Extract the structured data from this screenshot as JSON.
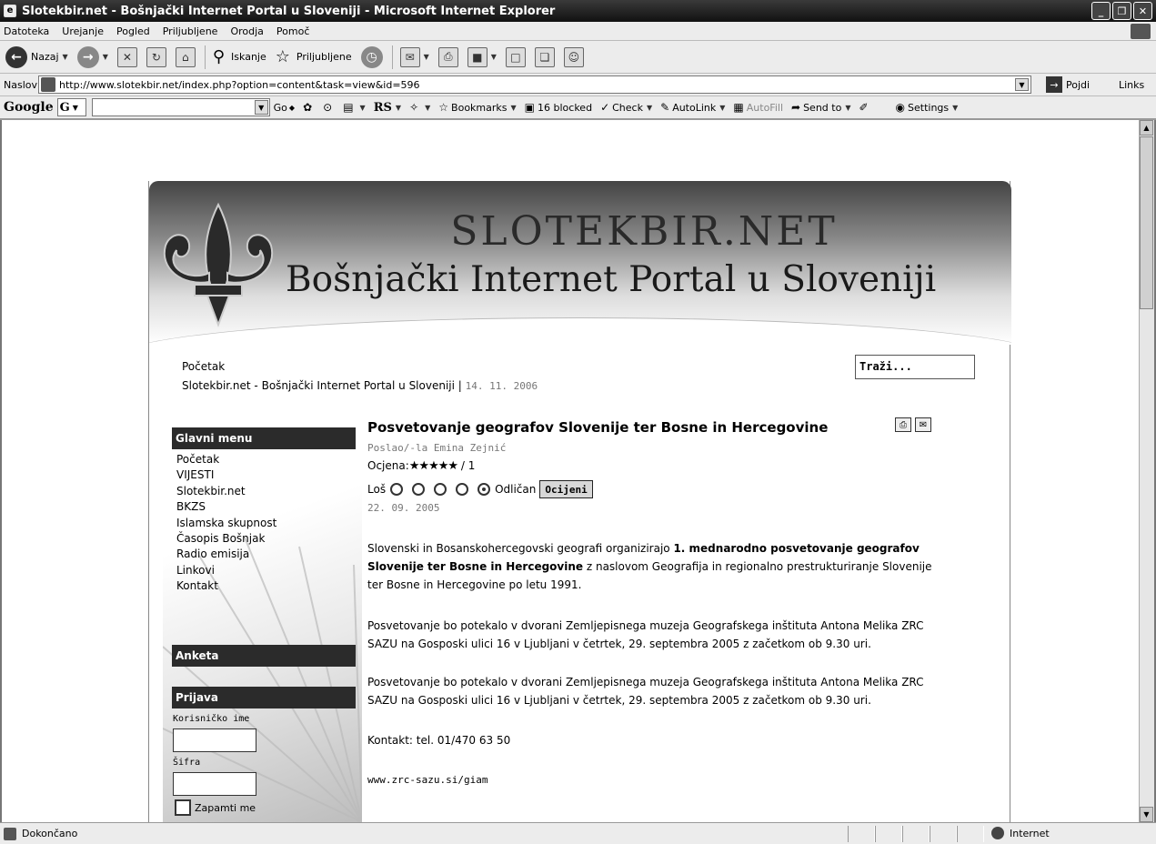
{
  "window": {
    "title": "Slotekbir.net - Bošnjački Internet Portal u Sloveniji - Microsoft Internet Explorer"
  },
  "menu": [
    "Datoteka",
    "Urejanje",
    "Pogled",
    "Priljubljene",
    "Orodja",
    "Pomoč"
  ],
  "toolbar": {
    "back": "Nazaj",
    "search": "Iskanje",
    "favorites": "Priljubljene"
  },
  "address": {
    "label": "Naslov",
    "url": "http://www.slotekbir.net/index.php?option=content&task=view&id=596",
    "go": "Pojdi",
    "links": "Links"
  },
  "google": {
    "logo": "Google",
    "g_button": "G",
    "go": "Go",
    "rs": "RS",
    "bookmarks": "Bookmarks",
    "blocked": "16 blocked",
    "check": "Check",
    "autolink": "AutoLink",
    "autofill": "AutoFill",
    "sendto": "Send to",
    "settings": "Settings"
  },
  "status": {
    "text": "Dokončano",
    "zone": "Internet"
  },
  "site": {
    "title": "SLOTEKBIR.NET",
    "subtitle": "Bošnjački Internet Portal u Sloveniji",
    "breadcrumb_home": "Početak",
    "breadcrumb_path": "Slotekbir.net - Bošnjački Internet Portal u Sloveniji",
    "breadcrumb_sep": " | ",
    "date": "14. 11. 2006",
    "search_value": "Traži..."
  },
  "sidebar": {
    "main_menu_header": "Glavni menu",
    "items": [
      "Početak",
      "VIJESTI",
      "Slotekbir.net",
      "BKZS",
      "Islamska skupnost",
      "Časopis Bošnjak",
      "Radio emisija",
      "Linkovi",
      "Kontakt"
    ],
    "poll_header": "Anketa",
    "login_header": "Prijava",
    "username_label": "Korisničko ime",
    "password_label": "Šifra",
    "remember_label": "Zapamti me"
  },
  "article": {
    "title": "Posvetovanje geografov Slovenije ter Bosne in Hercegovine",
    "author": "Poslao/-la Emina Zejnić",
    "rating_label": "Ocjena:",
    "rating_stars": "★★★★★",
    "rating_count": " / 1",
    "vote_low": "Loš",
    "vote_high": "Odličan",
    "vote_button": "Ocijeni",
    "date": "22. 09. 2005",
    "p1_a": "Slovenski in Bosanskohercegovski geografi organizirajo ",
    "p1_bold": "1. mednarodno posvetovanje geografov Slovenije ter Bosne in Hercegovine",
    "p1_b": " z naslovom Geografija in regionalno prestrukturiranje Slovenije ter Bosne in Hercegovine po letu 1991.",
    "p2": "Posvetovanje bo potekalo v dvorani Zemljepisnega muzeja Geografskega inštituta Antona Melika ZRC SAZU na Gosposki ulici 16 v Ljubljani v četrtek, 29. septembra 2005 z začetkom ob 9.30 uri.",
    "p3": "Posvetovanje bo potekalo v dvorani Zemljepisnega muzeja Geografskega inštituta Antona Melika ZRC SAZU na Gosposki ulici 16 v Ljubljani v četrtek, 29. septembra 2005 z začetkom ob 9.30 uri.",
    "contact": "Kontakt: tel. 01/470 63 50",
    "link": "www.zrc-sazu.si/giam"
  }
}
